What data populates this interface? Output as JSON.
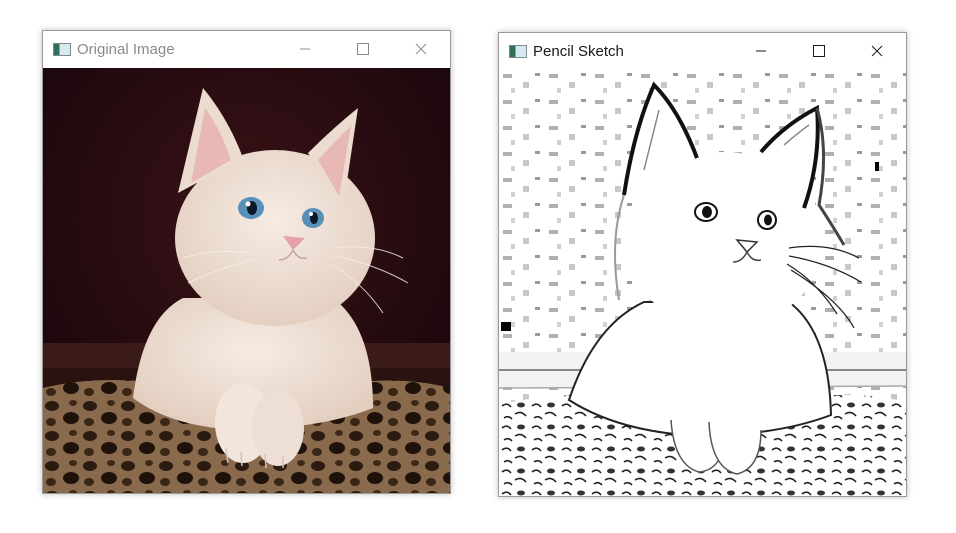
{
  "windows": [
    {
      "title": "Original Image",
      "state": "inactive",
      "content": "color kitten photograph"
    },
    {
      "title": "Pencil Sketch",
      "state": "active",
      "content": "pencil sketch of kitten"
    }
  ],
  "controls": [
    "minimize-icon",
    "maximize-icon",
    "close-icon"
  ],
  "colors": {
    "background": "#ffffff",
    "photo_backdrop": "#2a0c0e",
    "kitten_fur": "#efe2d6",
    "eye": "#5a8fb8",
    "nose": "#e8a0a8",
    "blanket": "#7a5b40"
  }
}
